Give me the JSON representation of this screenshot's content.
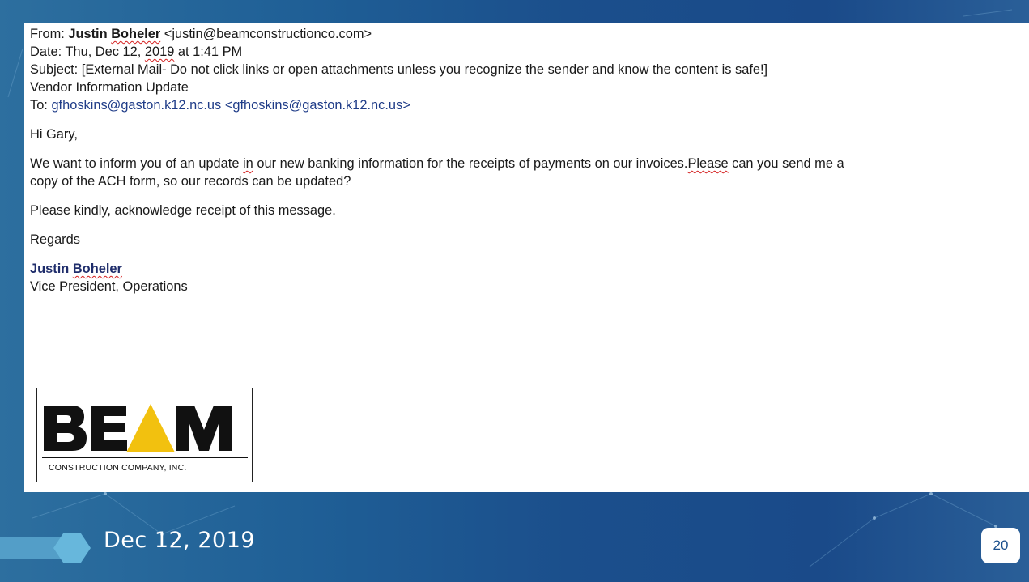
{
  "email": {
    "from_label": "From:",
    "from_first": "Justin",
    "from_last": "Boheler",
    "from_email": "<justin@beamconstructionco.com>",
    "date_label": "Date:",
    "date_prefix": "Thu, Dec 12,",
    "date_year": "2019",
    "date_suffix": "at 1:41 PM",
    "subject_label": "Subject:",
    "subject_text": "[External Mail- Do not click links or open attachments unless you recognize the sender and know the content is safe!]",
    "subject_line2": "Vendor Information Update",
    "to_label": "To:",
    "to_link": "gfhoskins@gaston.k12.nc.us",
    "to_email": "<gfhoskins@gaston.k12.nc.us>",
    "greeting": "Hi Gary,",
    "body_p1_a": "We want to inform you of an update",
    "body_p1_in": "in",
    "body_p1_b": "our new banking information for the receipts of payments on our invoices.",
    "body_p1_please": "Please",
    "body_p1_c": "can you send me a",
    "body_p1_line2": "copy of the ACH form, so our records can be updated?",
    "body_p2": "Please kindly, acknowledge receipt of this message.",
    "closing": "Regards",
    "sig_first": "Justin",
    "sig_last": "Boheler",
    "sig_title": "Vice President, Operations"
  },
  "logo": {
    "main_text": "BEAM",
    "sub_text": "CONSTRUCTION COMPANY, INC.",
    "accent_color": "#f2c10f"
  },
  "footer": {
    "date": "Dec 12, 2019",
    "page_number": "20"
  },
  "colors": {
    "background": "#1b4f8c",
    "link": "#1f3c88",
    "spellcheck": "#d42020"
  }
}
